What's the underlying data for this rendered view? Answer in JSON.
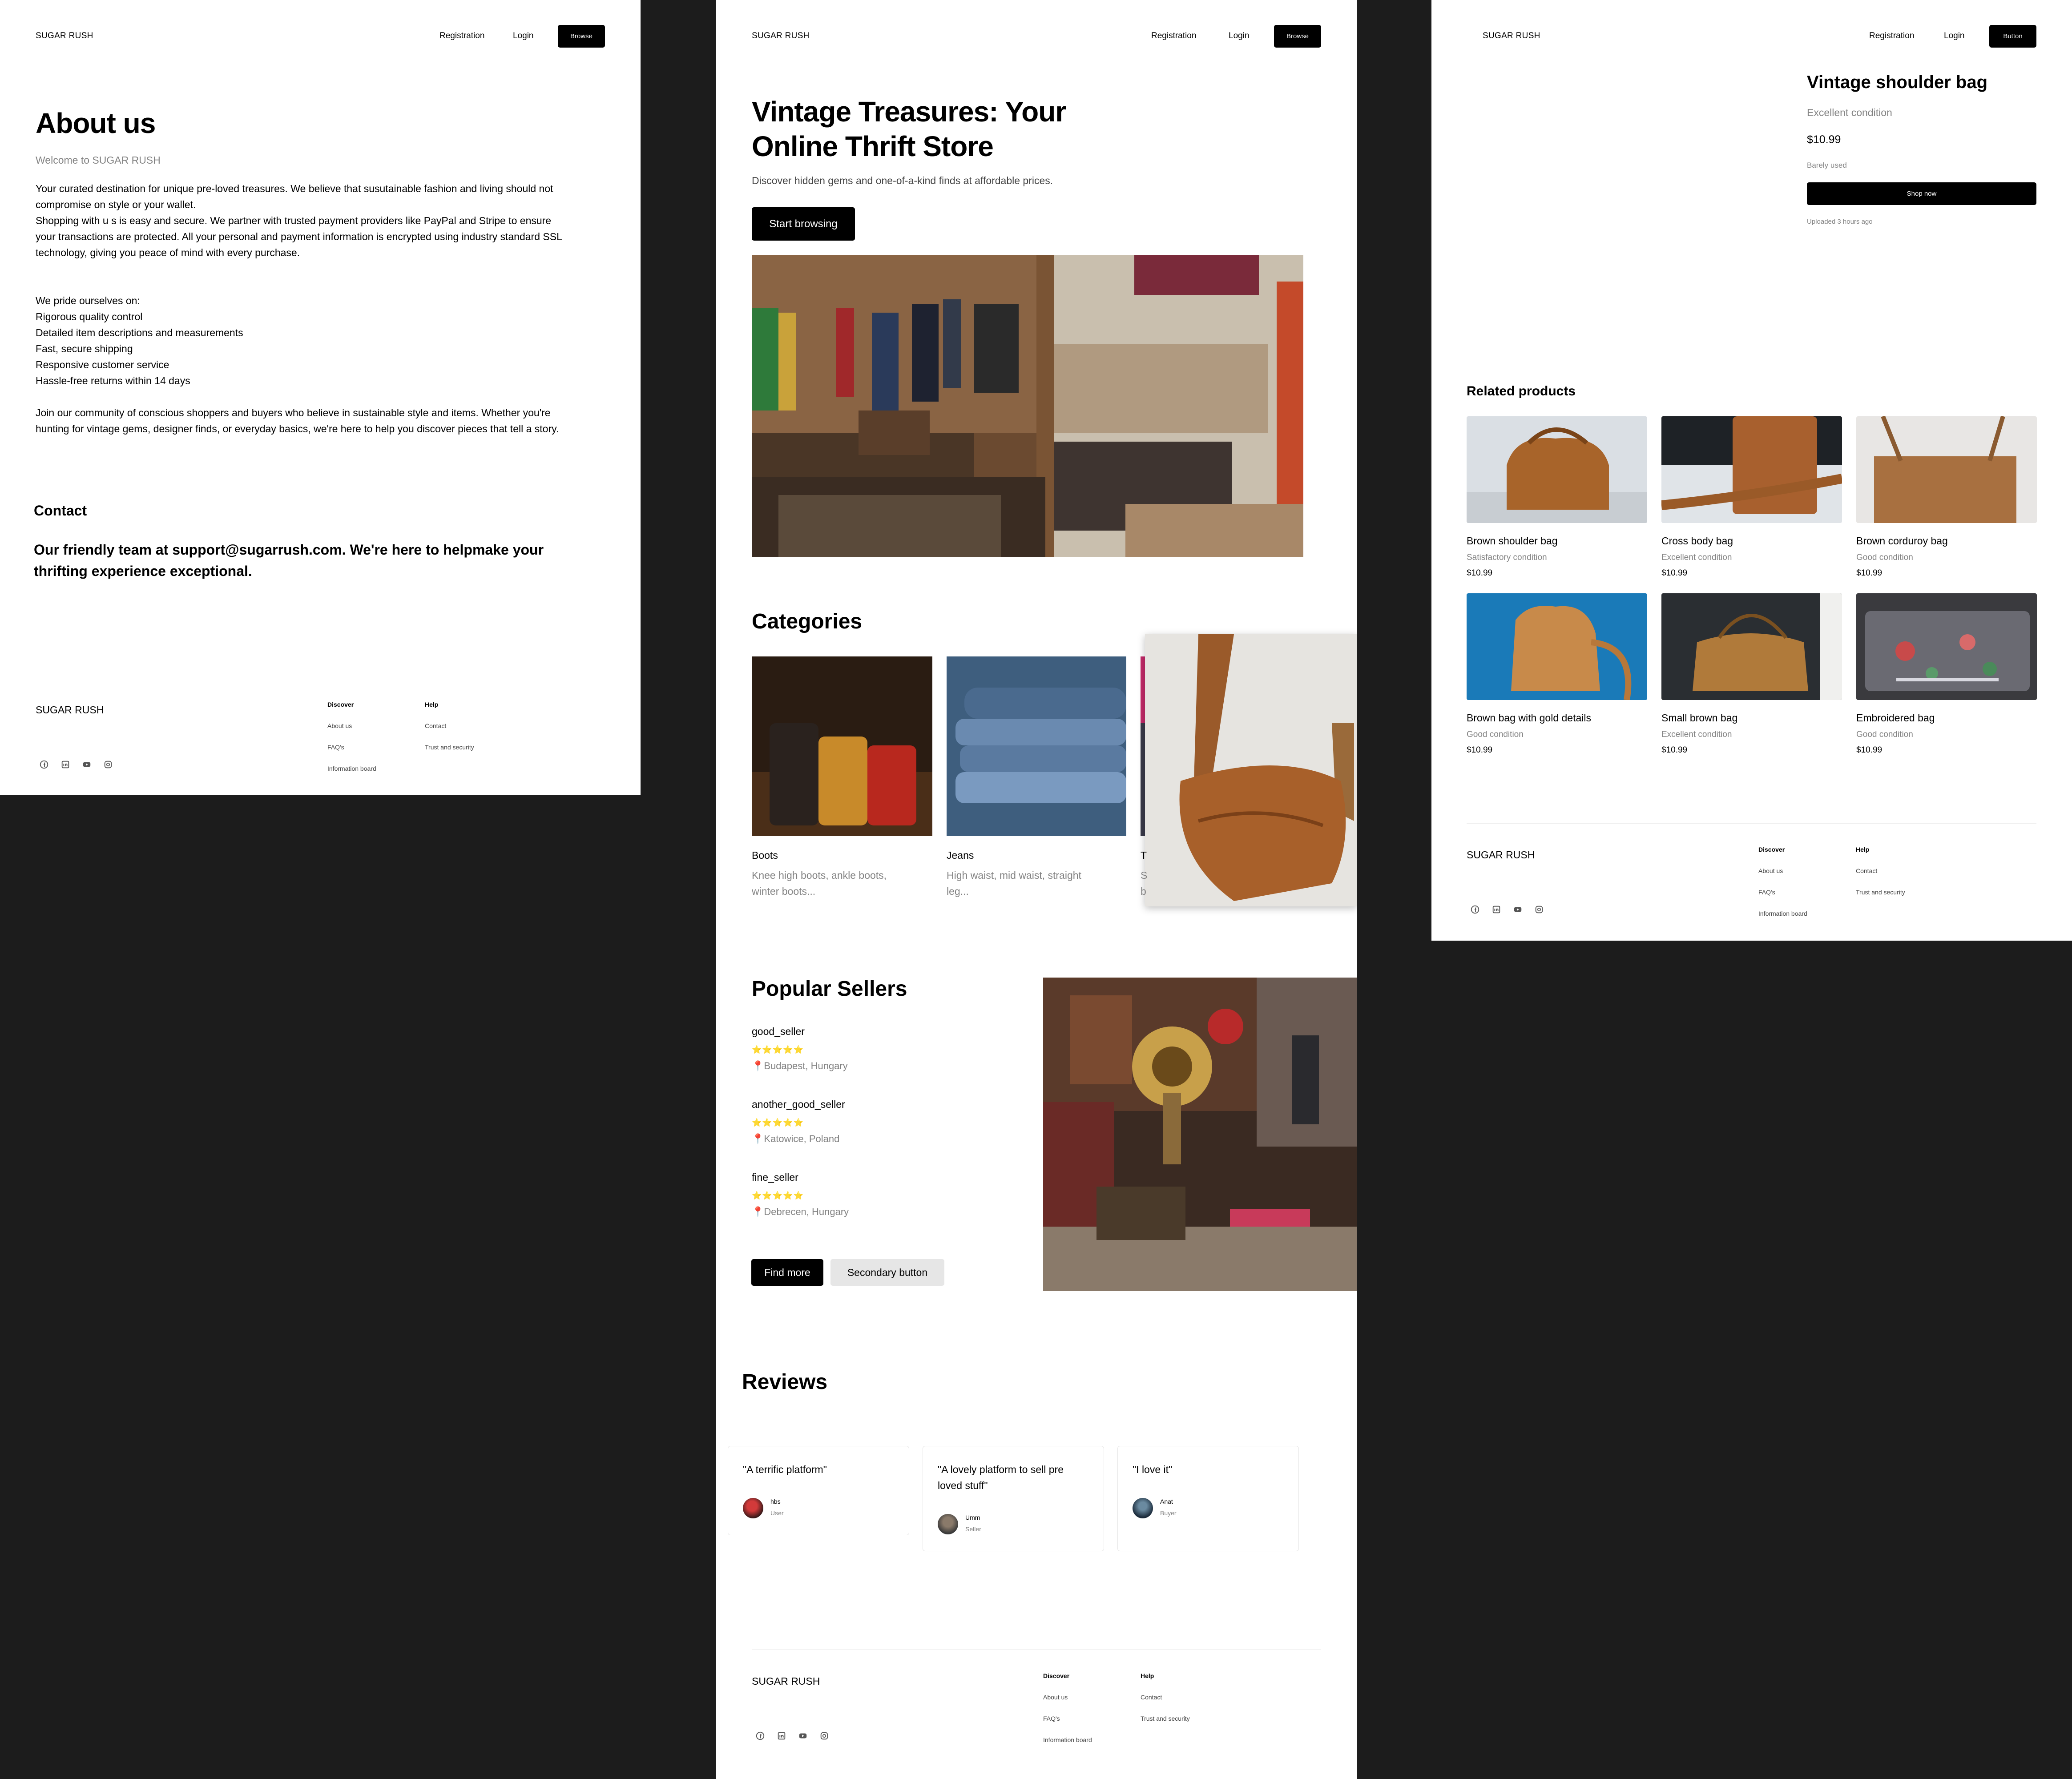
{
  "brand": "SUGAR RUSH",
  "nav": {
    "registration": "Registration",
    "login": "Login",
    "browse": "Browse",
    "button": "Button"
  },
  "about": {
    "title": "About us",
    "subtitle": "Welcome to SUGAR RUSH",
    "para1_line1": "Your curated destination for unique pre-loved treasures. We believe that susutainable fashion and living should not",
    "para1_line2": "compromise on style or your wallet.",
    "para1_line3": "Shopping with u s is easy and secure. We partner with trusted payment providers like PayPal and Stripe to ensure",
    "para1_line4": "your transactions are protected. All your personal and payment information is encrypted using industry standard  SSL",
    "para1_line5": "technology, giving you peace of mind with every purchase.",
    "pride_intro": "We pride ourselves on:",
    "pride_items": [
      "Rigorous quality control",
      "Detailed item descriptions and measurements",
      "Fast, secure shipping",
      "Responsive customer service",
      "Hassle-free returns within 14 days"
    ],
    "join_line1": "Join our community of conscious shoppers and buyers who believe in sustainable style and items. Whether you're",
    "join_line2": "hunting for vintage gems, designer finds, or everyday basics, we're here to help you discover pieces that tell a story.",
    "contact_title": "Contact",
    "contact_line1": "Our friendly team at support@sugarrush.com. We're here to helpmake your",
    "contact_line2": "thrifting experience exceptional."
  },
  "footer": {
    "discover_title": "Discover",
    "discover_links": [
      "About us",
      "FAQ's",
      "Information board"
    ],
    "help_title": "Help",
    "help_links": [
      "Contact",
      "Trust and security"
    ],
    "social_icons": [
      "facebook-icon",
      "linkedin-icon",
      "youtube-icon",
      "instagram-icon"
    ]
  },
  "home": {
    "hero_line1": "Vintage Treasures: Your",
    "hero_line2": "Online Thrift Store",
    "hero_sub": "Discover hidden gems and one-of-a-kind finds at affordable prices.",
    "cta": "Start browsing",
    "categories_title": "Categories",
    "categories": [
      {
        "name": "Boots",
        "desc1": "Knee high boots, ankle boots,",
        "desc2": "winter boots..."
      },
      {
        "name": "Jeans",
        "desc1": "High waist, mid waist, straight",
        "desc2": "leg..."
      },
      {
        "name": "T",
        "desc1": "S",
        "desc2": "b"
      }
    ],
    "sellers_title": "Popular Sellers",
    "sellers": [
      {
        "name": "good_seller",
        "stars": "⭐⭐⭐⭐⭐",
        "location": "📍Budapest, Hungary"
      },
      {
        "name": "another_good_seller",
        "stars": "⭐⭐⭐⭐⭐",
        "location": "📍Katowice, Poland"
      },
      {
        "name": "fine_seller",
        "stars": "⭐⭐⭐⭐⭐",
        "location": "📍Debrecen, Hungary"
      }
    ],
    "find_more": "Find more",
    "secondary": "Secondary button",
    "reviews_title": "Reviews",
    "reviews": [
      {
        "quote1": "\"A terrific platform\"",
        "quote2": "",
        "user": "hbs",
        "role": "User"
      },
      {
        "quote1": "\"A lovely platform to sell pre",
        "quote2": "loved stuff\"",
        "user": "Umm",
        "role": "Seller"
      },
      {
        "quote1": "\"I love it\"",
        "quote2": "",
        "user": "Anat",
        "role": "Buyer"
      }
    ]
  },
  "product": {
    "title": "Vintage shoulder bag",
    "condition": "Excellent condition",
    "price": "$10.99",
    "note": "Barely used",
    "shop_now": "Shop now",
    "uploaded": "Uploaded 3 hours ago",
    "related_title": "Related products",
    "related": [
      {
        "name": "Brown shoulder bag",
        "condition": "Satisfactory condition",
        "price": "$10.99"
      },
      {
        "name": "Cross body bag",
        "condition": "Excellent condition",
        "price": "$10.99"
      },
      {
        "name": "Brown corduroy  bag",
        "condition": "Good condition",
        "price": "$10.99"
      },
      {
        "name": "Brown bag with gold details",
        "condition": "Good condition",
        "price": "$10.99"
      },
      {
        "name": "Small brown bag",
        "condition": "Excellent condition",
        "price": "$10.99"
      },
      {
        "name": "Embroidered bag",
        "condition": "Good condition",
        "price": "$10.99"
      }
    ]
  }
}
